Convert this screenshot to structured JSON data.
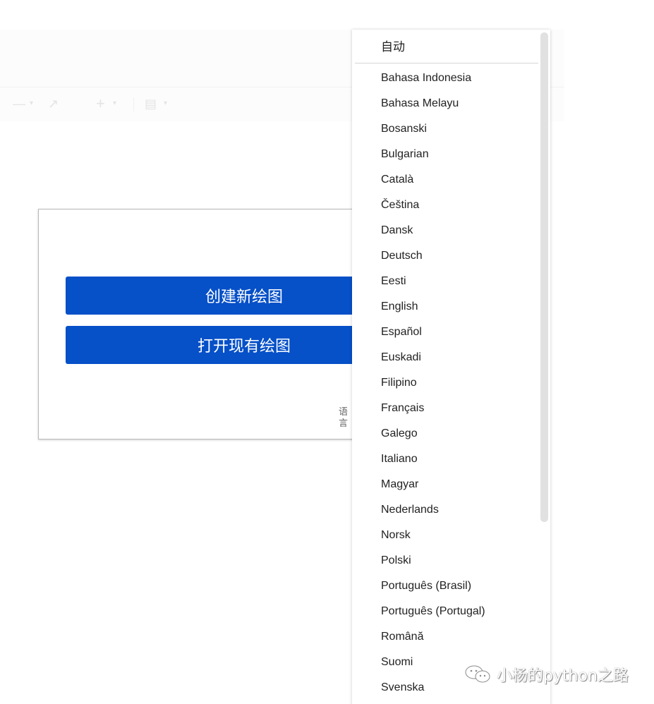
{
  "background_app": {
    "toolbar_icons": [
      "zoom-out-icon",
      "redo-icon",
      "insert-plus-icon",
      "format-panel-icon"
    ]
  },
  "dialog": {
    "create_button_label": "创建新绘图",
    "open_button_label": "打开现有绘图",
    "language_link_label": "语言",
    "accent_color": "#0650c8"
  },
  "language_menu": {
    "auto_label": "自动",
    "items": [
      "Bahasa Indonesia",
      "Bahasa Melayu",
      "Bosanski",
      "Bulgarian",
      "Català",
      "Čeština",
      "Dansk",
      "Deutsch",
      "Eesti",
      "English",
      "Español",
      "Euskadi",
      "Filipino",
      "Français",
      "Galego",
      "Italiano",
      "Magyar",
      "Nederlands",
      "Norsk",
      "Polski",
      "Português (Brasil)",
      "Português (Portugal)",
      "Română",
      "Suomi",
      "Svenska"
    ]
  },
  "watermark": {
    "text": "小杨的python之路",
    "icon": "wechat-icon"
  }
}
